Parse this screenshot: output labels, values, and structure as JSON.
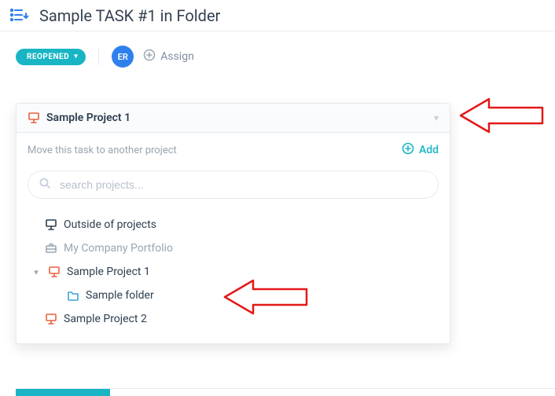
{
  "header": {
    "task_title": "Sample TASK #1 in Folder"
  },
  "toolbar": {
    "status_label": "REOPENED",
    "avatar_initials": "ER",
    "assign_label": "Assign"
  },
  "panel": {
    "title": "Sample Project 1",
    "subtitle": "Move this task to another project",
    "add_label": "Add",
    "search_placeholder": "search projects..."
  },
  "tree": {
    "outside": "Outside of projects",
    "portfolio": "My Company Portfolio",
    "project1": "Sample Project 1",
    "folder": "Sample folder",
    "project2": "Sample Project 2"
  },
  "colors": {
    "teal": "#19b5c4",
    "blue": "#2f80ed",
    "orange": "#e9613e",
    "muted": "#9aa5b1",
    "folder_blue": "#3ba3d4",
    "red": "#e31818"
  }
}
